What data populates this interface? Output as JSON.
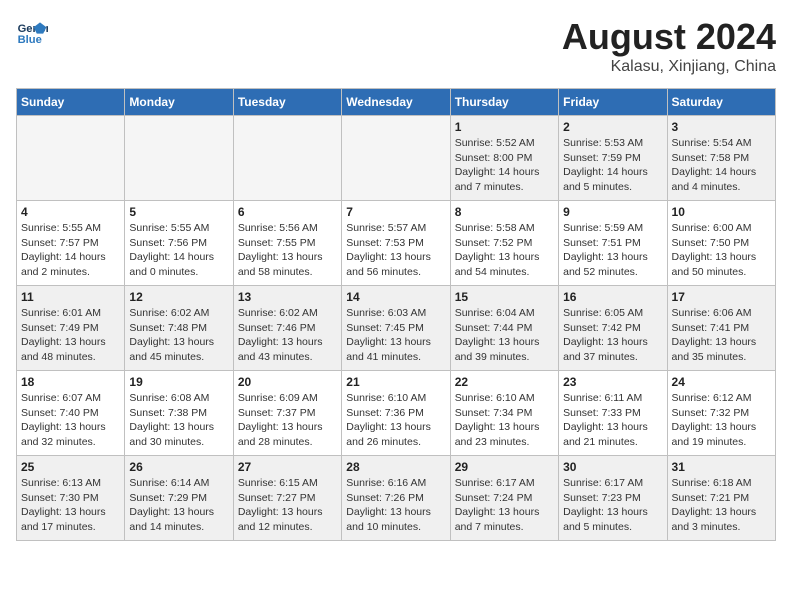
{
  "header": {
    "logo_line1": "General",
    "logo_line2": "Blue",
    "main_title": "August 2024",
    "subtitle": "Kalasu, Xinjiang, China"
  },
  "weekdays": [
    "Sunday",
    "Monday",
    "Tuesday",
    "Wednesday",
    "Thursday",
    "Friday",
    "Saturday"
  ],
  "weeks": [
    [
      {
        "day": "",
        "empty": true
      },
      {
        "day": "",
        "empty": true
      },
      {
        "day": "",
        "empty": true
      },
      {
        "day": "",
        "empty": true
      },
      {
        "day": "1",
        "sunrise": "5:52 AM",
        "sunset": "8:00 PM",
        "daylight": "14 hours and 7 minutes."
      },
      {
        "day": "2",
        "sunrise": "5:53 AM",
        "sunset": "7:59 PM",
        "daylight": "14 hours and 5 minutes."
      },
      {
        "day": "3",
        "sunrise": "5:54 AM",
        "sunset": "7:58 PM",
        "daylight": "14 hours and 4 minutes."
      }
    ],
    [
      {
        "day": "4",
        "sunrise": "5:55 AM",
        "sunset": "7:57 PM",
        "daylight": "14 hours and 2 minutes."
      },
      {
        "day": "5",
        "sunrise": "5:55 AM",
        "sunset": "7:56 PM",
        "daylight": "14 hours and 0 minutes."
      },
      {
        "day": "6",
        "sunrise": "5:56 AM",
        "sunset": "7:55 PM",
        "daylight": "13 hours and 58 minutes."
      },
      {
        "day": "7",
        "sunrise": "5:57 AM",
        "sunset": "7:53 PM",
        "daylight": "13 hours and 56 minutes."
      },
      {
        "day": "8",
        "sunrise": "5:58 AM",
        "sunset": "7:52 PM",
        "daylight": "13 hours and 54 minutes."
      },
      {
        "day": "9",
        "sunrise": "5:59 AM",
        "sunset": "7:51 PM",
        "daylight": "13 hours and 52 minutes."
      },
      {
        "day": "10",
        "sunrise": "6:00 AM",
        "sunset": "7:50 PM",
        "daylight": "13 hours and 50 minutes."
      }
    ],
    [
      {
        "day": "11",
        "sunrise": "6:01 AM",
        "sunset": "7:49 PM",
        "daylight": "13 hours and 48 minutes."
      },
      {
        "day": "12",
        "sunrise": "6:02 AM",
        "sunset": "7:48 PM",
        "daylight": "13 hours and 45 minutes."
      },
      {
        "day": "13",
        "sunrise": "6:02 AM",
        "sunset": "7:46 PM",
        "daylight": "13 hours and 43 minutes."
      },
      {
        "day": "14",
        "sunrise": "6:03 AM",
        "sunset": "7:45 PM",
        "daylight": "13 hours and 41 minutes."
      },
      {
        "day": "15",
        "sunrise": "6:04 AM",
        "sunset": "7:44 PM",
        "daylight": "13 hours and 39 minutes."
      },
      {
        "day": "16",
        "sunrise": "6:05 AM",
        "sunset": "7:42 PM",
        "daylight": "13 hours and 37 minutes."
      },
      {
        "day": "17",
        "sunrise": "6:06 AM",
        "sunset": "7:41 PM",
        "daylight": "13 hours and 35 minutes."
      }
    ],
    [
      {
        "day": "18",
        "sunrise": "6:07 AM",
        "sunset": "7:40 PM",
        "daylight": "13 hours and 32 minutes."
      },
      {
        "day": "19",
        "sunrise": "6:08 AM",
        "sunset": "7:38 PM",
        "daylight": "13 hours and 30 minutes."
      },
      {
        "day": "20",
        "sunrise": "6:09 AM",
        "sunset": "7:37 PM",
        "daylight": "13 hours and 28 minutes."
      },
      {
        "day": "21",
        "sunrise": "6:10 AM",
        "sunset": "7:36 PM",
        "daylight": "13 hours and 26 minutes."
      },
      {
        "day": "22",
        "sunrise": "6:10 AM",
        "sunset": "7:34 PM",
        "daylight": "13 hours and 23 minutes."
      },
      {
        "day": "23",
        "sunrise": "6:11 AM",
        "sunset": "7:33 PM",
        "daylight": "13 hours and 21 minutes."
      },
      {
        "day": "24",
        "sunrise": "6:12 AM",
        "sunset": "7:32 PM",
        "daylight": "13 hours and 19 minutes."
      }
    ],
    [
      {
        "day": "25",
        "sunrise": "6:13 AM",
        "sunset": "7:30 PM",
        "daylight": "13 hours and 17 minutes."
      },
      {
        "day": "26",
        "sunrise": "6:14 AM",
        "sunset": "7:29 PM",
        "daylight": "13 hours and 14 minutes."
      },
      {
        "day": "27",
        "sunrise": "6:15 AM",
        "sunset": "7:27 PM",
        "daylight": "13 hours and 12 minutes."
      },
      {
        "day": "28",
        "sunrise": "6:16 AM",
        "sunset": "7:26 PM",
        "daylight": "13 hours and 10 minutes."
      },
      {
        "day": "29",
        "sunrise": "6:17 AM",
        "sunset": "7:24 PM",
        "daylight": "13 hours and 7 minutes."
      },
      {
        "day": "30",
        "sunrise": "6:17 AM",
        "sunset": "7:23 PM",
        "daylight": "13 hours and 5 minutes."
      },
      {
        "day": "31",
        "sunrise": "6:18 AM",
        "sunset": "7:21 PM",
        "daylight": "13 hours and 3 minutes."
      }
    ]
  ]
}
